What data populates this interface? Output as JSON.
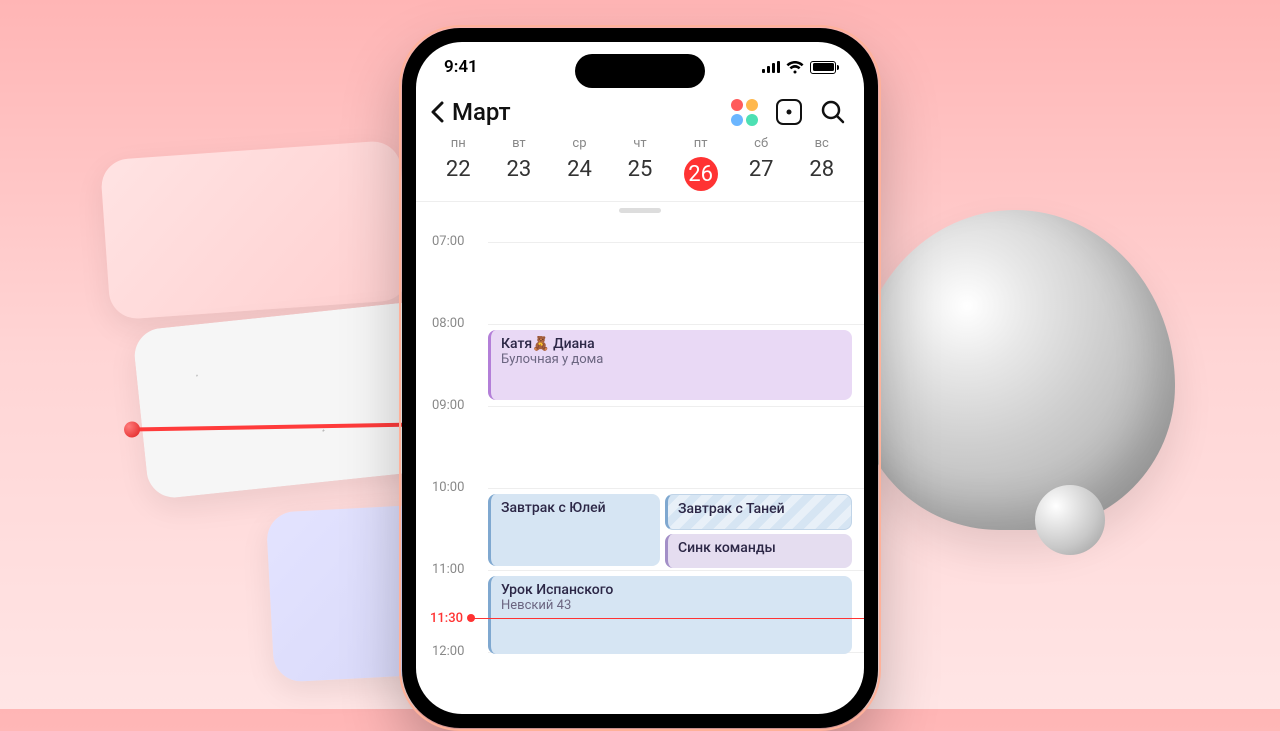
{
  "status": {
    "time": "9:41"
  },
  "header": {
    "month": "Март"
  },
  "week": {
    "days": [
      {
        "name": "пн",
        "num": "22"
      },
      {
        "name": "вт",
        "num": "23"
      },
      {
        "name": "ср",
        "num": "24"
      },
      {
        "name": "чт",
        "num": "25"
      },
      {
        "name": "пт",
        "num": "26",
        "selected": true
      },
      {
        "name": "сб",
        "num": "27"
      },
      {
        "name": "вс",
        "num": "28"
      }
    ]
  },
  "timeline": {
    "hours": [
      "07:00",
      "08:00",
      "09:00",
      "10:00",
      "11:00",
      "12:00"
    ],
    "now": "11:30"
  },
  "events": {
    "e1": {
      "title": "Катя🧸 Диана",
      "sub": "Булочная у дома"
    },
    "e2": {
      "title": "Завтрак с Юлей"
    },
    "e3": {
      "title": "Завтрак с Таней"
    },
    "e4": {
      "title": "Синк команды"
    },
    "e5": {
      "title": "Урок Испанского",
      "sub": "Невский 43"
    }
  }
}
